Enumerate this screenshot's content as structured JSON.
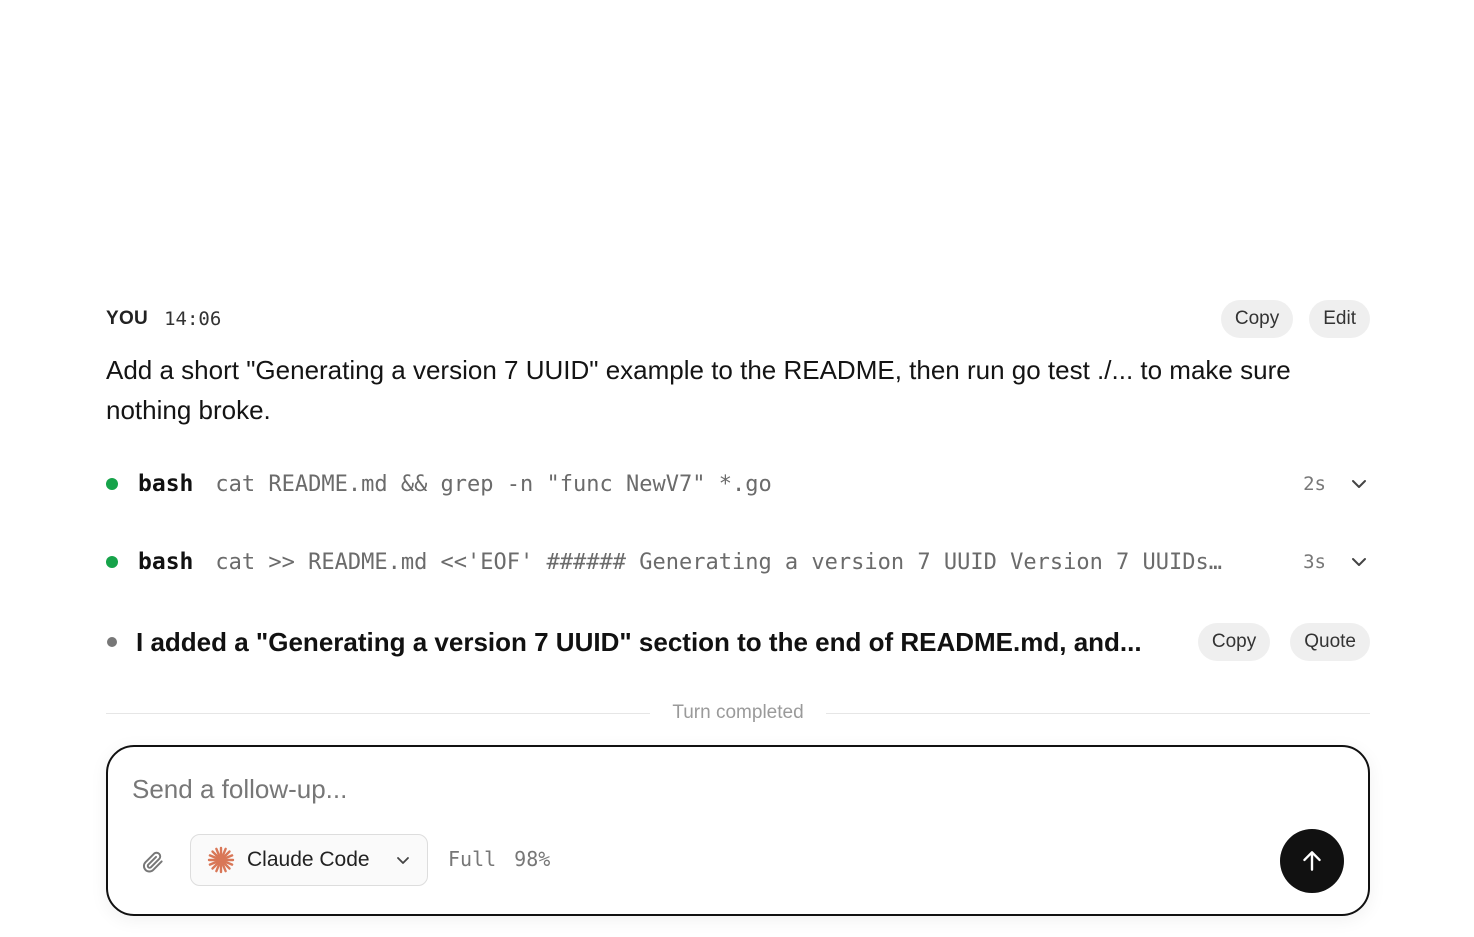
{
  "user_message": {
    "author": "YOU",
    "time": "14:06",
    "copy_label": "Copy",
    "edit_label": "Edit",
    "text": "Add a short \"Generating a version 7 UUID\" example to the README, then run go test ./... to make sure nothing broke."
  },
  "steps": [
    {
      "tool": "bash",
      "command": "cat README.md && grep -n \"func NewV7\" *.go",
      "duration": "2s",
      "status_color": "#16a34a"
    },
    {
      "tool": "bash",
      "command": "cat >> README.md <<'EOF' ###### Generating a version 7 UUID Version 7 UUIDs…",
      "duration": "3s",
      "status_color": "#16a34a"
    }
  ],
  "assistant_reply": {
    "text": "I added a \"Generating a version 7 UUID\" section to the end of README.md, and...",
    "copy_label": "Copy",
    "quote_label": "Quote"
  },
  "divider": {
    "label": "Turn completed"
  },
  "composer": {
    "placeholder": "Send a follow-up...",
    "agent": "Claude Code",
    "mode": "Full",
    "context": "98%",
    "attach_icon": "paperclip-icon",
    "agent_icon": "claude-starburst-icon",
    "send_icon": "arrow-up-icon",
    "accent_color": "#d97757"
  }
}
